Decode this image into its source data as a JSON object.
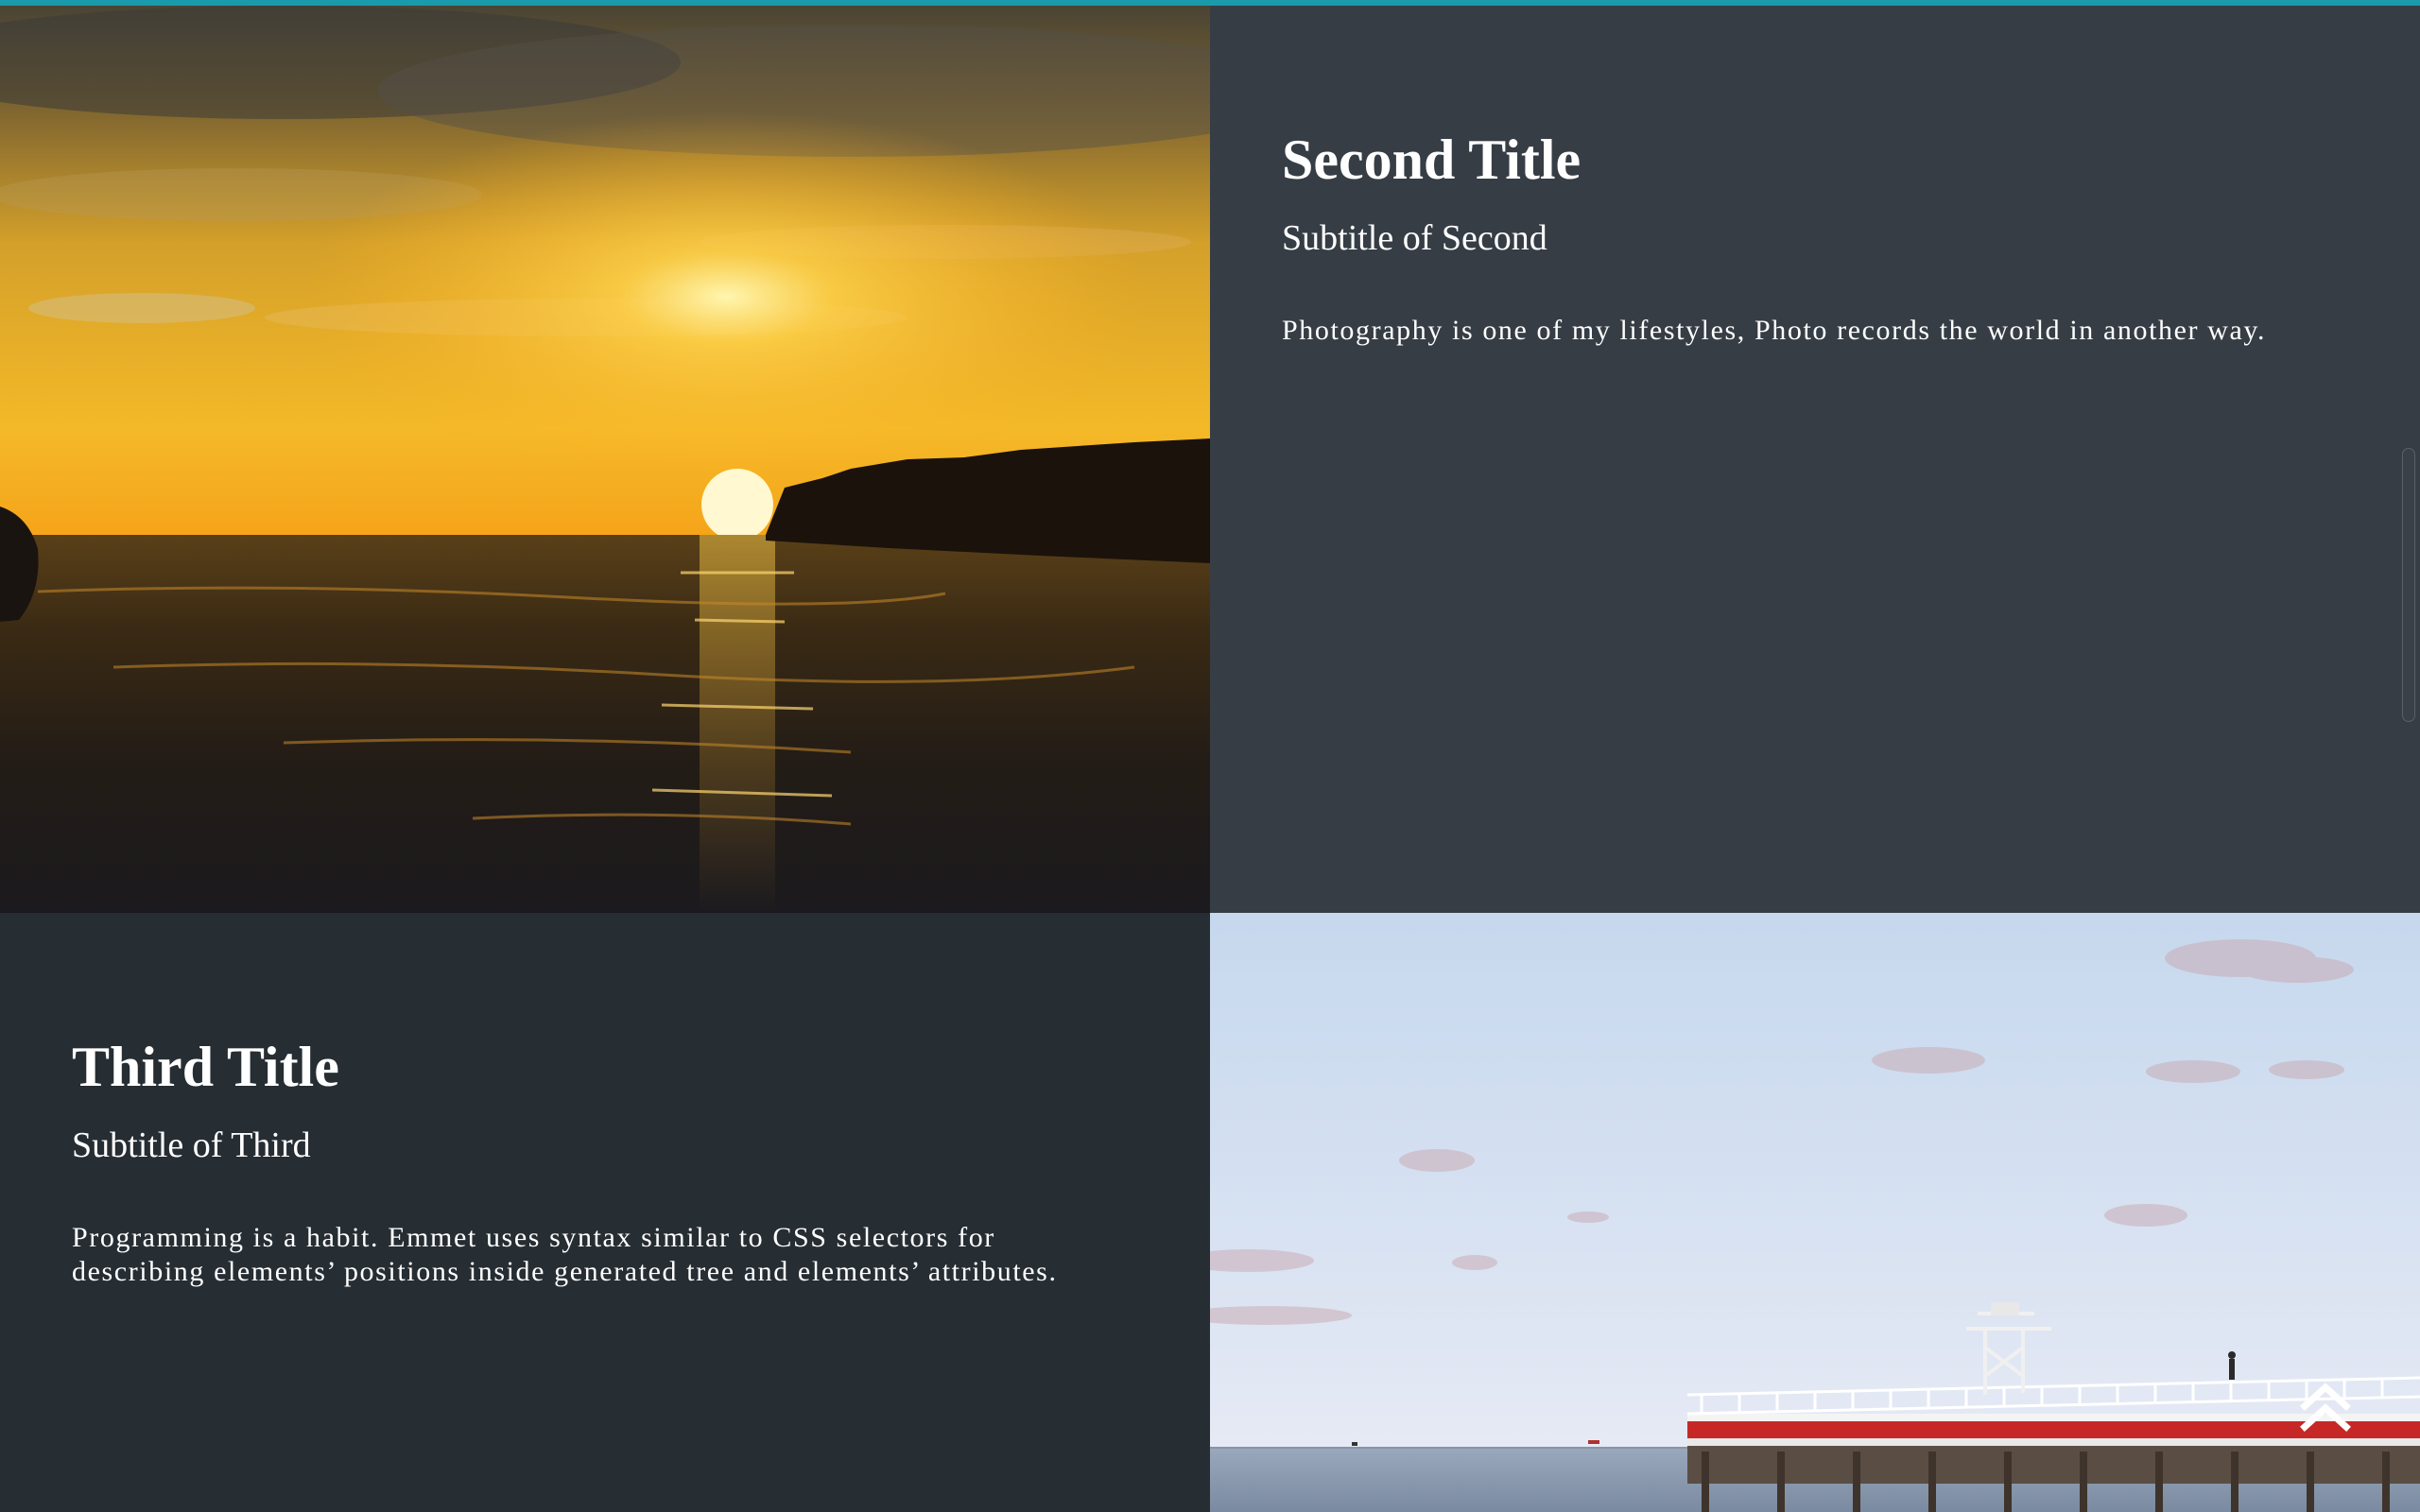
{
  "accent_color": "#1a9aaa",
  "sections": {
    "second": {
      "title": "Second Title",
      "subtitle": "Subtitle of Second",
      "body": "Photography is one of my lifestyles, Photo records the world in another way.",
      "image": "sunset-over-sea-photo"
    },
    "third": {
      "title": "Third Title",
      "subtitle": "Subtitle of Third",
      "body": "Programming is a habit. Emmet uses syntax similar to CSS selectors for describing elements’ positions inside generated tree and elements’ attributes.",
      "image": "pier-by-the-sea-photo"
    }
  },
  "icons": {
    "back_to_top": "double-chevron-up-icon"
  }
}
